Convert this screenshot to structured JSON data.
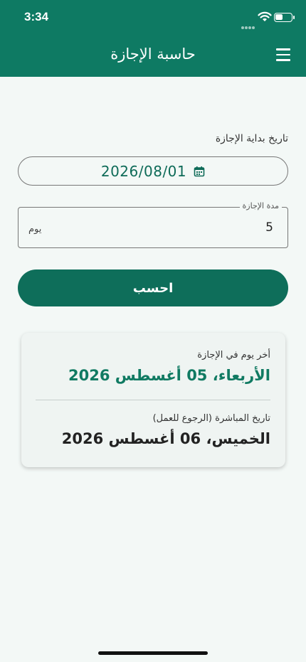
{
  "status_bar": {
    "time": "3:34"
  },
  "header": {
    "title": "حاسبة الإجازة",
    "menu_icon": "hamburger-menu-icon"
  },
  "form": {
    "start_label": "تاريخ بداية الإجازة",
    "start_date": "2026/08/01",
    "calendar_icon": "calendar-icon",
    "duration_label": "مدة الإجازة",
    "duration_value": "5",
    "duration_unit": "يوم",
    "calculate_label": "احسب"
  },
  "results": {
    "last_day_label": "أخر يوم في الإجازة",
    "last_day_value": "الأربعاء، 05 أغسطس 2026",
    "return_label": "تاريخ المباشرة (الرجوع للعمل)",
    "return_value": "الخميس، 06 أغسطس 2026"
  },
  "colors": {
    "brand": "#0e7a63",
    "button": "#0e6e5a",
    "accent_text": "#107a62",
    "background": "#f3f8f6"
  }
}
